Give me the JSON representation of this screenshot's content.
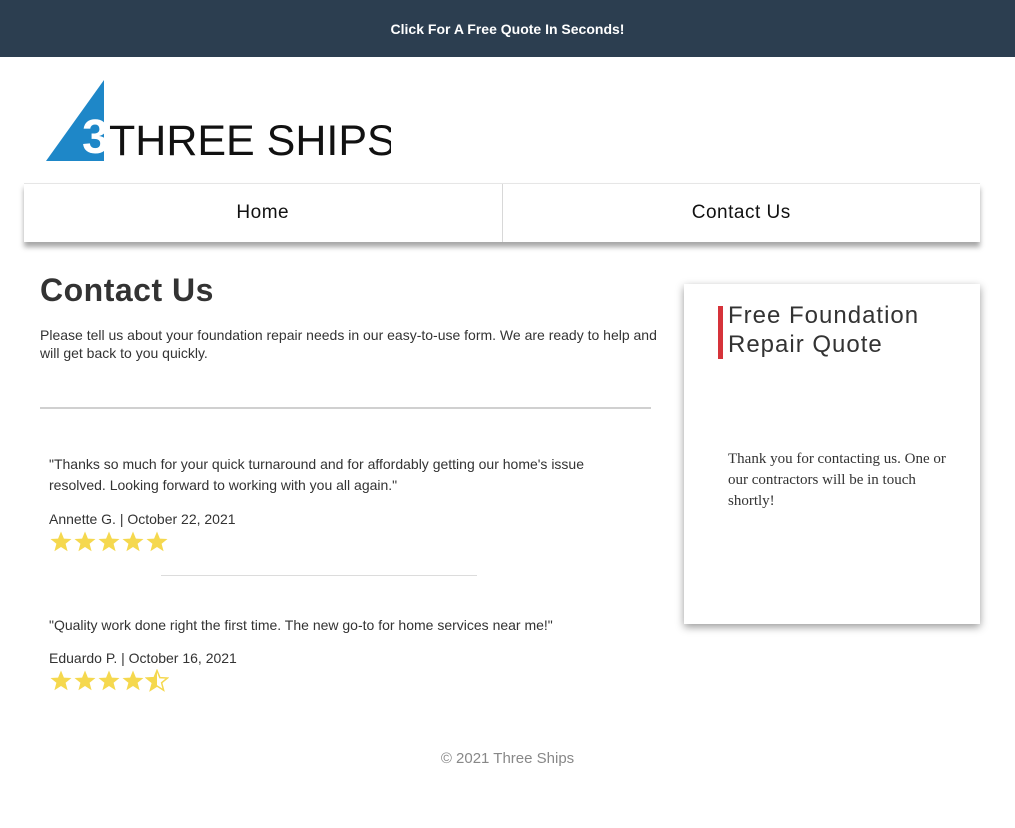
{
  "topbar": {
    "cta_label": "Click For A Free Quote In Seconds!"
  },
  "logo": {
    "text": "THREE SHIPS",
    "sail_numeral": "3",
    "sail_color": "#1e87c8"
  },
  "nav": {
    "items": [
      {
        "label": "Home"
      },
      {
        "label": "Contact Us"
      }
    ]
  },
  "main": {
    "title": "Contact Us",
    "intro": "Please tell us about your foundation repair needs in our easy-to-use form. We are ready to help and will get back to you quickly.",
    "reviews": [
      {
        "quote": "\"Thanks so much for your quick turnaround and for affordably getting our home's issue resolved. Looking forward to working with you all again.\"",
        "author": "Annette G. | October 22, 2021",
        "rating": 5
      },
      {
        "quote": "\"Quality work done right the first time. The new go-to for home services near me!\"",
        "author": "Eduardo P. | October 16, 2021",
        "rating": 4.5
      }
    ]
  },
  "sidebar": {
    "title": "Free Foundation Repair Quote",
    "message": "Thank you for contacting us. One or our contractors will be in touch shortly!"
  },
  "footer": {
    "copyright": "© 2021 Three Ships"
  },
  "colors": {
    "topbar_bg": "#2c3e50",
    "accent_red": "#d6333a",
    "star_gold": "#f5d84e",
    "logo_blue": "#1e87c8"
  },
  "icons": {
    "star_full": "star-icon",
    "star_half": "star-half-icon"
  }
}
